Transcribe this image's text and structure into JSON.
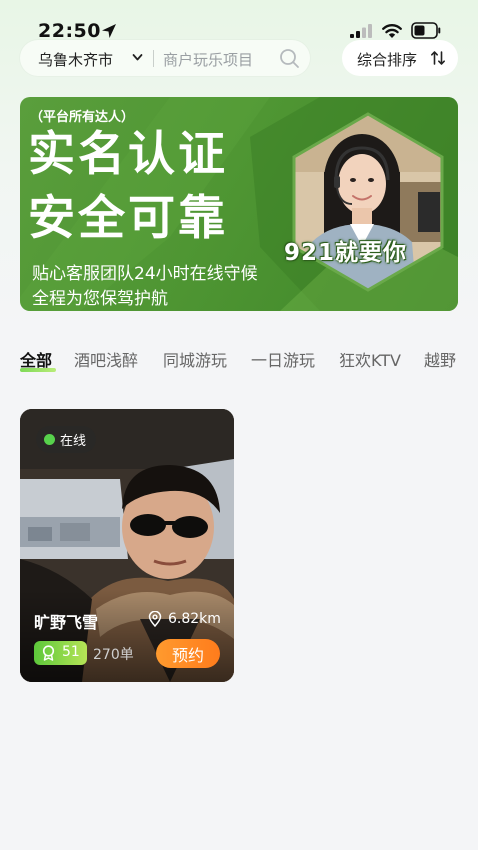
{
  "status_bar": {
    "time": "22:50"
  },
  "search_bar": {
    "city": "乌鲁木齐市",
    "placeholder": "商户玩乐项目"
  },
  "sort": {
    "label": "综合排序"
  },
  "banner": {
    "subtitle": "（平台所有达人）",
    "headline_line1": "实名认证",
    "headline_line2": "安全可靠",
    "slogan": "921就要你",
    "desc_line1": "贴心客服团队24小时在线守候",
    "desc_line2": "全程为您保驾护航"
  },
  "tabs": [
    {
      "label": "全部",
      "active": true
    },
    {
      "label": "酒吧浅醉",
      "active": false
    },
    {
      "label": "同城游玩",
      "active": false
    },
    {
      "label": "一日游玩",
      "active": false
    },
    {
      "label": "狂欢KTV",
      "active": false
    },
    {
      "label": "越野",
      "active": false
    }
  ],
  "cards": [
    {
      "status": "在线",
      "name": "旷野飞雪",
      "distance": "6.82km",
      "rating": "51",
      "orders": "270单",
      "book_label": "预约"
    }
  ],
  "colors": {
    "accent_green": "#5dc83b",
    "banner_green": "#4f9633",
    "book_orange": "#ff8a24",
    "online_dot": "#57d24c"
  }
}
